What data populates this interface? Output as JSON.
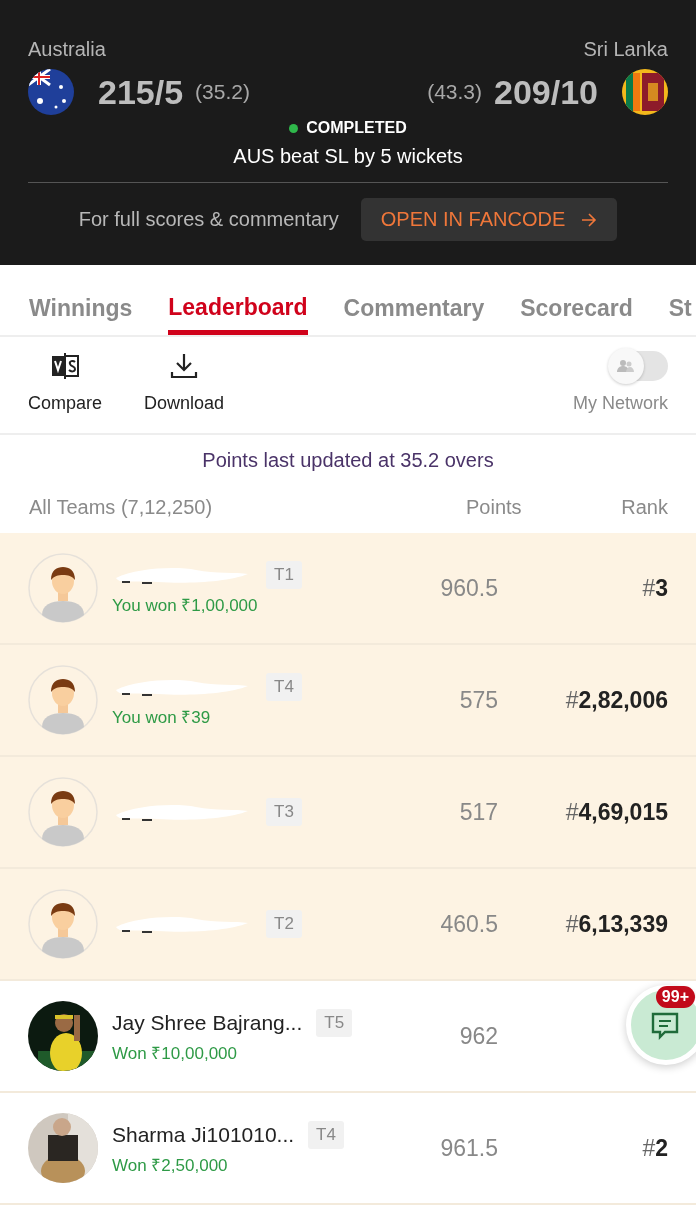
{
  "match": {
    "team_a": {
      "name": "Australia",
      "score": "215/5",
      "overs": "(35.2)"
    },
    "team_b": {
      "name": "Sri Lanka",
      "score": "209/10",
      "overs": "(43.3)"
    },
    "status": "COMPLETED",
    "result": "AUS beat SL by 5 wickets",
    "promo_text": "For full scores & commentary",
    "promo_button": "OPEN IN FANCODE"
  },
  "tabs": [
    {
      "label": "Winnings",
      "selected": false
    },
    {
      "label": "Leaderboard",
      "selected": true
    },
    {
      "label": "Commentary",
      "selected": false
    },
    {
      "label": "Scorecard",
      "selected": false
    },
    {
      "label": "St",
      "selected": false
    }
  ],
  "toolbar": {
    "compare": "Compare",
    "download": "Download",
    "network": {
      "label": "My Network",
      "on": false
    }
  },
  "update_note": "Points last updated at 35.2 overs",
  "table": {
    "columns": [
      "All Teams (7,12,250)",
      "Points",
      "Rank"
    ],
    "rows": [
      {
        "avatar": {
          "kind": "default"
        },
        "name_redacted": true,
        "team": "T1",
        "winnings": "You won ₹1,00,000",
        "points": "960.5",
        "rank_prefix": "#",
        "rank": "3",
        "highlighted": true
      },
      {
        "avatar": {
          "kind": "default"
        },
        "name_redacted": true,
        "team": "T4",
        "winnings": "You won ₹39",
        "points": "575",
        "rank_prefix": "#",
        "rank": "2,82,006",
        "highlighted": true
      },
      {
        "avatar": {
          "kind": "default"
        },
        "name_redacted": true,
        "team": "T3",
        "points": "517",
        "rank_prefix": "#",
        "rank": "4,69,015",
        "highlighted": true
      },
      {
        "avatar": {
          "kind": "default"
        },
        "name_redacted": true,
        "team": "T2",
        "points": "460.5",
        "rank_prefix": "#",
        "rank": "6,13,339",
        "highlighted": true
      },
      {
        "name": "Jay Shree Bajrang...",
        "team": "T5",
        "winnings": "Won ₹10,00,000",
        "points": "962",
        "highlighted": false
      },
      {
        "name": "Sharma Ji101010...",
        "team": "T4",
        "winnings": "Won ₹2,50,000",
        "points": "961.5",
        "rank_prefix": "#",
        "rank": "2",
        "highlighted": false
      }
    ]
  },
  "chat_badge": "99+"
}
